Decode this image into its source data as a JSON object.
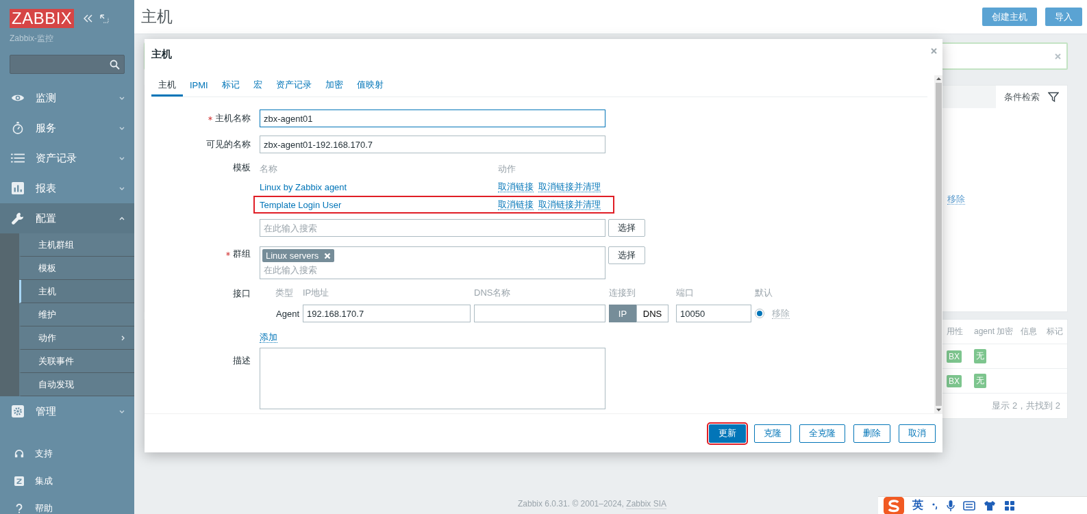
{
  "sidebar": {
    "logo": "ZABBIX",
    "subtitle": "Zabbix-监控",
    "menu": [
      {
        "label": "监测",
        "expanded": false
      },
      {
        "label": "服务",
        "expanded": false
      },
      {
        "label": "资产记录",
        "expanded": false
      },
      {
        "label": "报表",
        "expanded": false
      },
      {
        "label": "配置",
        "expanded": true,
        "children": [
          {
            "label": "主机群组",
            "selected": false,
            "submenu": false
          },
          {
            "label": "模板",
            "selected": false,
            "submenu": false
          },
          {
            "label": "主机",
            "selected": true,
            "submenu": false
          },
          {
            "label": "维护",
            "selected": false,
            "submenu": false
          },
          {
            "label": "动作",
            "selected": false,
            "submenu": true
          },
          {
            "label": "关联事件",
            "selected": false,
            "submenu": false
          },
          {
            "label": "自动发现",
            "selected": false,
            "submenu": false
          }
        ]
      },
      {
        "label": "管理",
        "expanded": false
      }
    ],
    "links": [
      "支持",
      "集成",
      "帮助"
    ]
  },
  "page": {
    "title": "主机",
    "actions": [
      "创建主机",
      "导入"
    ]
  },
  "background": {
    "filter_tab": "条件检索",
    "filter_link": "移除",
    "table": {
      "columns": [
        "用性",
        "agent 加密",
        "信息",
        "标记"
      ],
      "rows": [
        {
          "column_1": "BX",
          "agent_encryption": "无"
        },
        {
          "column_1": "BX",
          "agent_encryption": "无"
        }
      ]
    },
    "summary": "显示 2，共找到 2"
  },
  "footer": {
    "text": "Zabbix 6.0.31. © 2001–2024, ",
    "link": "Zabbix SIA"
  },
  "modal": {
    "title": "主机",
    "tabs": [
      {
        "label": "主机",
        "selected": true
      },
      {
        "label": "IPMI",
        "selected": false
      },
      {
        "label": "标记",
        "selected": false
      },
      {
        "label": "宏",
        "selected": false
      },
      {
        "label": "资产记录",
        "selected": false
      },
      {
        "label": "加密",
        "selected": false
      },
      {
        "label": "值映射",
        "selected": false
      }
    ],
    "host_name": {
      "label": "主机名称",
      "required": true,
      "value": "zbx-agent01"
    },
    "visible_name": {
      "label": "可见的名称",
      "required": false,
      "value": "zbx-agent01-192.168.170.7"
    },
    "templates": {
      "label": "模板",
      "columns": [
        "名称",
        "动作"
      ],
      "rows": [
        {
          "name": "Linux by Zabbix agent",
          "unlink": "取消链接",
          "unlink_clear": "取消链接并清理",
          "highlighted": false
        },
        {
          "name": "Template Login User",
          "unlink": "取消链接",
          "unlink_clear": "取消链接并清理",
          "highlighted": true
        }
      ],
      "placeholder": "在此输入搜索",
      "select": "选择"
    },
    "groups": {
      "label": "群组",
      "required": true,
      "tags": [
        "Linux servers"
      ],
      "placeholder": "在此输入搜索",
      "select": "选择"
    },
    "interfaces": {
      "label": "接口",
      "columns": [
        "类型",
        "IP地址",
        "DNS名称",
        "连接到",
        "端口",
        "默认"
      ],
      "rows": [
        {
          "type": "Agent",
          "ip": "192.168.170.7",
          "connect_to": [
            {
              "label": "IP",
              "selected": true
            },
            {
              "label": "DNS",
              "selected": false
            }
          ],
          "port": "10050",
          "default": true,
          "remove": {
            "label": "移除",
            "disabled": true
          }
        }
      ],
      "add": "添加"
    },
    "description": {
      "label": "描述"
    },
    "buttons": [
      {
        "label": "更新",
        "kind": "primary",
        "highlighted": true
      },
      {
        "label": "克隆",
        "kind": "secondary",
        "highlighted": false
      },
      {
        "label": "全克隆",
        "kind": "secondary",
        "highlighted": false
      },
      {
        "label": "删除",
        "kind": "secondary",
        "highlighted": false
      },
      {
        "label": "取消",
        "kind": "secondary",
        "highlighted": false
      }
    ]
  },
  "ime_toolbar": {
    "mode": "英"
  }
}
